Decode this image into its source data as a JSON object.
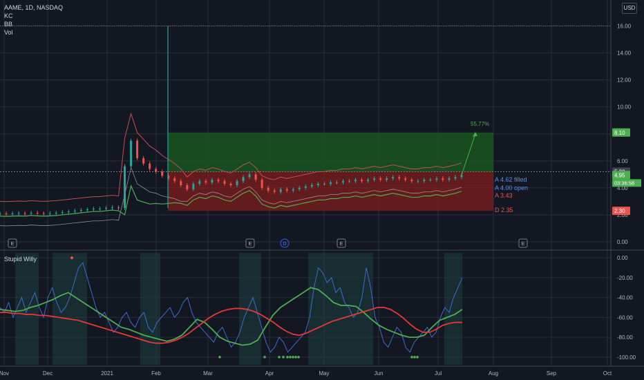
{
  "header": {
    "symbol_line": "AAME, 1D, NASDAQ",
    "indicators": [
      "KC",
      "BB",
      "Vol"
    ],
    "currency": "USD"
  },
  "colors": {
    "background": "#131722",
    "grid": "#2a2e39",
    "bull": "#26a69a",
    "bear": "#ef5350",
    "profit_zone": "#1b5e20",
    "loss_zone": "#7f1d1d",
    "wave_blue": "#3f6bd1",
    "wave_green": "#4caf50",
    "wave_red": "#e53935",
    "marker_bull": "#4caf50",
    "marker_bear": "#ef5350"
  },
  "chart_data": [
    {
      "type": "line",
      "title": "AAME, 1D, NASDAQ",
      "ylim": [
        0,
        17
      ],
      "x_ticks": [
        "Nov",
        "Dec",
        "2021",
        "Feb",
        "Mar",
        "Apr",
        "May",
        "Jun",
        "Jul",
        "Aug",
        "Sep",
        "Oct"
      ],
      "y_ticks": [
        "0.00",
        "2.00",
        "4.00",
        "6.00",
        "8.00",
        "10.00",
        "12.00",
        "14.00",
        "16.00"
      ],
      "series": [
        {
          "values": [
            2.1,
            2.08,
            2.1,
            2.12,
            2.1,
            2.15,
            2.12,
            2.1,
            2.12,
            2.15,
            2.2,
            2.25,
            2.3,
            2.35,
            2.4,
            2.45,
            2.45,
            2.5,
            2.55,
            2.5,
            5.6,
            7.5,
            6.2,
            5.8,
            5.4,
            5.2,
            4.9,
            4.7,
            4.5,
            4.2,
            3.9,
            4.3,
            4.5,
            4.4,
            4.6,
            4.5,
            4.3,
            4.2,
            4.5,
            4.8,
            5.0,
            4.6,
            4.0,
            3.8,
            3.7,
            3.9,
            3.8,
            3.9,
            4.0,
            4.1,
            4.2,
            4.3,
            4.3,
            4.4,
            4.4,
            4.5,
            4.5,
            4.6,
            4.5,
            4.6,
            4.7,
            4.6,
            4.7,
            4.8,
            4.7,
            4.6,
            4.5,
            4.5,
            4.6,
            4.6,
            4.7,
            4.6,
            4.7,
            4.8,
            4.95
          ]
        }
      ],
      "price_labels": [
        {
          "value": 8.1,
          "text": "8.10",
          "color": "#4caf50"
        },
        {
          "value": 5.2,
          "text": "5.20",
          "color": "#434651"
        },
        {
          "value": 4.95,
          "text": "4.95",
          "color": "#4caf50"
        },
        {
          "value": 2.3,
          "text": "2.30",
          "color": "#ef5350"
        }
      ],
      "countdown": "03:36:58",
      "position": {
        "target": 8.1,
        "entry": 5.2,
        "stop": 2.3,
        "target_pct_text": "55.77%"
      },
      "annotations": [
        {
          "text": "A 4.62 filled",
          "y": 4.62,
          "color": "#5b8def"
        },
        {
          "text": "A 4.00 open",
          "y": 4.0,
          "color": "#5b8def"
        },
        {
          "text": "A 3.43",
          "y": 3.43,
          "color": "#ef5350"
        },
        {
          "text": "D 2.35",
          "y": 2.35,
          "color": "#ef5350"
        }
      ],
      "event_markers": [
        "E",
        "E",
        "D",
        "E",
        "E"
      ]
    },
    {
      "type": "line",
      "title": "Stupid Willy",
      "ylim": [
        -105,
        5
      ],
      "y_ticks": [
        "0.00",
        "-20.00",
        "-40.00",
        "-60.00",
        "-80.00",
        "-100.00"
      ],
      "series": [
        {
          "values": [
            -50,
            -55,
            -45,
            -60,
            -50,
            -40,
            -55,
            -45,
            -35,
            -50,
            -60,
            -40,
            -30,
            -45,
            -55,
            -50,
            -40,
            -25,
            -10,
            -5,
            -20,
            -35,
            -50,
            -60,
            -55,
            -65,
            -75,
            -70,
            -60,
            -55,
            -65,
            -70,
            -60,
            -55,
            -70,
            -75,
            -65,
            -60,
            -55,
            -50,
            -60,
            -55,
            -45,
            -40,
            -55,
            -65,
            -70,
            -75,
            -80,
            -85,
            -75,
            -70,
            -80,
            -90,
            -85,
            -75,
            -60,
            -50,
            -40,
            -55,
            -70,
            -85,
            -95,
            -90,
            -80,
            -85,
            -95,
            -90,
            -85,
            -80,
            -75,
            -60,
            -30,
            -10,
            -15,
            -25,
            -20,
            -35,
            -30,
            -45,
            -50,
            -60,
            -55,
            -40,
            -10,
            -30,
            -60,
            -70,
            -85,
            -90,
            -80,
            -70,
            -75,
            -90,
            -95,
            -85,
            -80,
            -75,
            -70,
            -80,
            -75,
            -60,
            -50,
            -55,
            -40,
            -30,
            -20
          ]
        },
        {
          "values": [
            -52,
            -53,
            -54,
            -53,
            -50,
            -48,
            -45,
            -42,
            -38,
            -35,
            -40,
            -45,
            -50,
            -55,
            -60,
            -65,
            -70,
            -72,
            -75,
            -78,
            -80,
            -82,
            -84,
            -82,
            -78,
            -70,
            -62,
            -65,
            -72,
            -80,
            -84,
            -86,
            -88,
            -87,
            -83,
            -70,
            -58,
            -50,
            -45,
            -40,
            -35,
            -30,
            -32,
            -38,
            -45,
            -48,
            -48,
            -49,
            -55,
            -62,
            -68,
            -72,
            -75,
            -78,
            -80,
            -80,
            -78,
            -70,
            -63,
            -60,
            -57,
            -52
          ]
        },
        {
          "values": [
            -55,
            -55,
            -56,
            -56,
            -57,
            -57,
            -58,
            -58,
            -59,
            -60,
            -61,
            -62,
            -63,
            -65,
            -67,
            -69,
            -71,
            -73,
            -75,
            -77,
            -79,
            -81,
            -83,
            -85,
            -86,
            -86,
            -85,
            -83,
            -80,
            -76,
            -71,
            -66,
            -61,
            -57,
            -54,
            -52,
            -51,
            -51,
            -52,
            -54,
            -57,
            -61,
            -65,
            -70,
            -74,
            -77,
            -78,
            -76,
            -73,
            -70,
            -67,
            -64,
            -62,
            -60,
            -58,
            -56,
            -54,
            -52,
            -50,
            -50,
            -52,
            -56,
            -61,
            -67,
            -72,
            -75,
            -75,
            -72,
            -68,
            -66,
            -65,
            -65
          ]
        }
      ]
    }
  ]
}
